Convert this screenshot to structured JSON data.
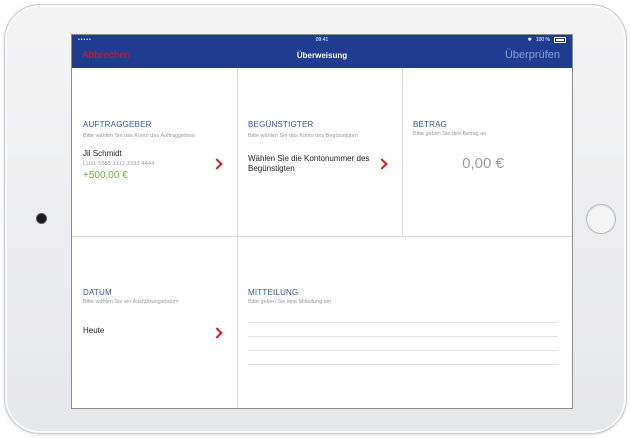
{
  "status": {
    "carrier": "•••••",
    "time": "09:41",
    "bluetooth": "✱",
    "battery": "100 %"
  },
  "nav": {
    "cancel": "Abbrechen",
    "title": "Überweisung",
    "check": "Überprüfen"
  },
  "ordering_party": {
    "title": "AUFTRAGGEBER",
    "subtitle": "Bitte wählen Sie das Konto des Auftraggebers",
    "name": "Jil Schmidt",
    "iban": "LU11 5555 1111 3333 4444",
    "balance": "+500,00 €"
  },
  "beneficiary": {
    "title": "BEGÜNSTIGTER",
    "subtitle": "Bitte wählen Sie das Konto des Begünstigten",
    "prompt": "Wählen Sie die Kontonummer des Begünstigten"
  },
  "amount": {
    "title": "BETRAG",
    "subtitle": "Bitte geben Sie den Betrag an",
    "value": "0,00 €"
  },
  "date": {
    "title": "DATUM",
    "subtitle": "Bitte wählen Sie ein Ausführungsdatum",
    "value": "Heute"
  },
  "message": {
    "title": "MITTEILUNG",
    "subtitle": "Bitte geben Sie eine Mitteilung ein"
  },
  "colors": {
    "nav_bar": "#1f3c91",
    "accent_red": "#e0131d",
    "section_title": "#2f57a8",
    "balance_green": "#6cb043"
  }
}
